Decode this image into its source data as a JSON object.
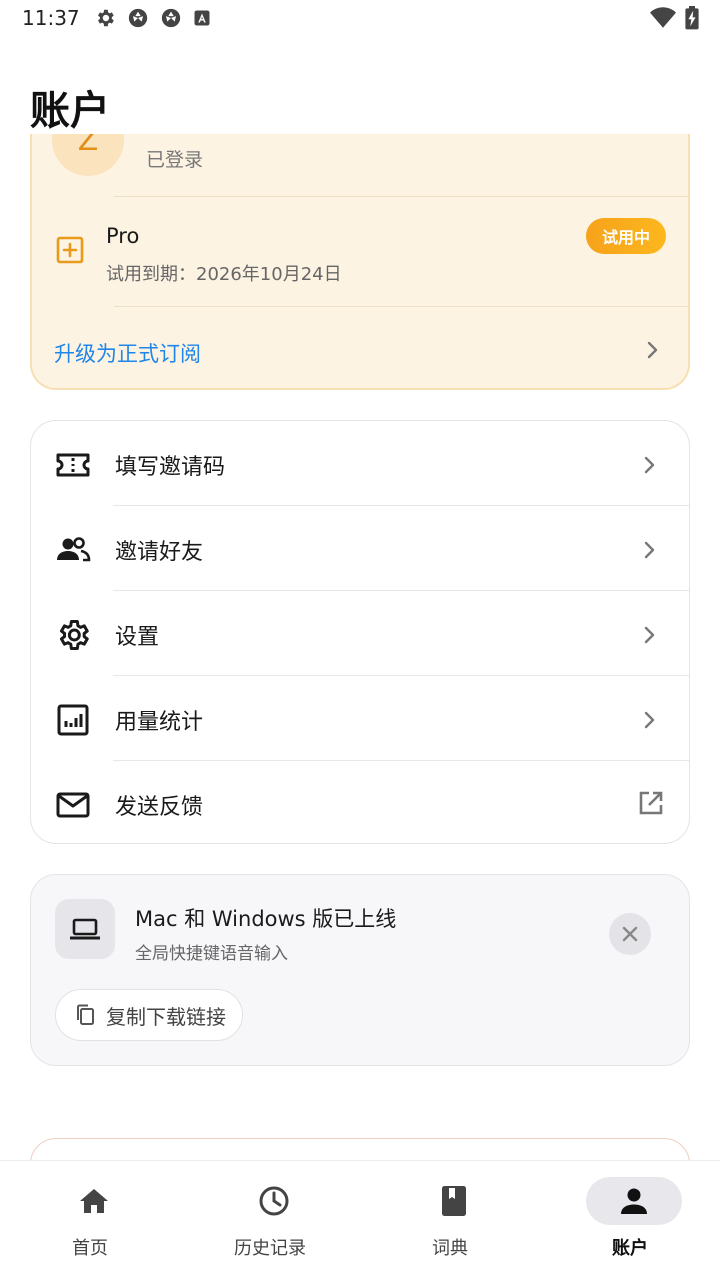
{
  "status_bar": {
    "time": "11:37"
  },
  "page": {
    "title": "账户"
  },
  "account": {
    "avatar_letter": "Z",
    "login_status": "已登录"
  },
  "pro": {
    "name": "Pro",
    "expiry": "试用到期：2026年10月24日",
    "badge": "试用中",
    "upgrade_label": "升级为正式订阅",
    "accent": "#f5a623",
    "link_color": "#1f86ea"
  },
  "menu": {
    "items": [
      {
        "label": "填写邀请码",
        "icon": "ticket-icon"
      },
      {
        "label": "邀请好友",
        "icon": "people-icon"
      },
      {
        "label": "设置",
        "icon": "gear-icon"
      },
      {
        "label": "用量统计",
        "icon": "bar-chart-icon"
      },
      {
        "label": "发送反馈",
        "icon": "mail-icon"
      }
    ]
  },
  "promo": {
    "title": "Mac 和 Windows 版已上线",
    "subtitle": "全局快捷键语音输入",
    "copy_label": "复制下载链接"
  },
  "bottom_nav": {
    "items": [
      {
        "label": "首页",
        "icon": "home-icon"
      },
      {
        "label": "历史记录",
        "icon": "clock-icon"
      },
      {
        "label": "词典",
        "icon": "book-icon"
      },
      {
        "label": "账户",
        "icon": "person-icon",
        "active": true
      }
    ]
  }
}
